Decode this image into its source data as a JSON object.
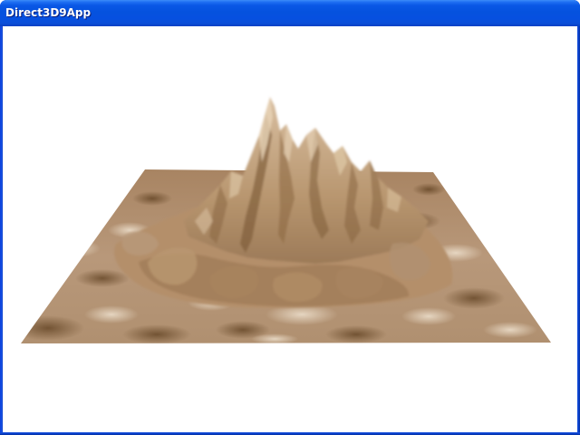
{
  "window": {
    "title": "Direct3D9App"
  },
  "viewport": {
    "background_color": "#ffffff",
    "terrain_color": "#b89676",
    "terrain_dark_color": "#6b4a28",
    "terrain_light_color": "#e6d2b8"
  }
}
